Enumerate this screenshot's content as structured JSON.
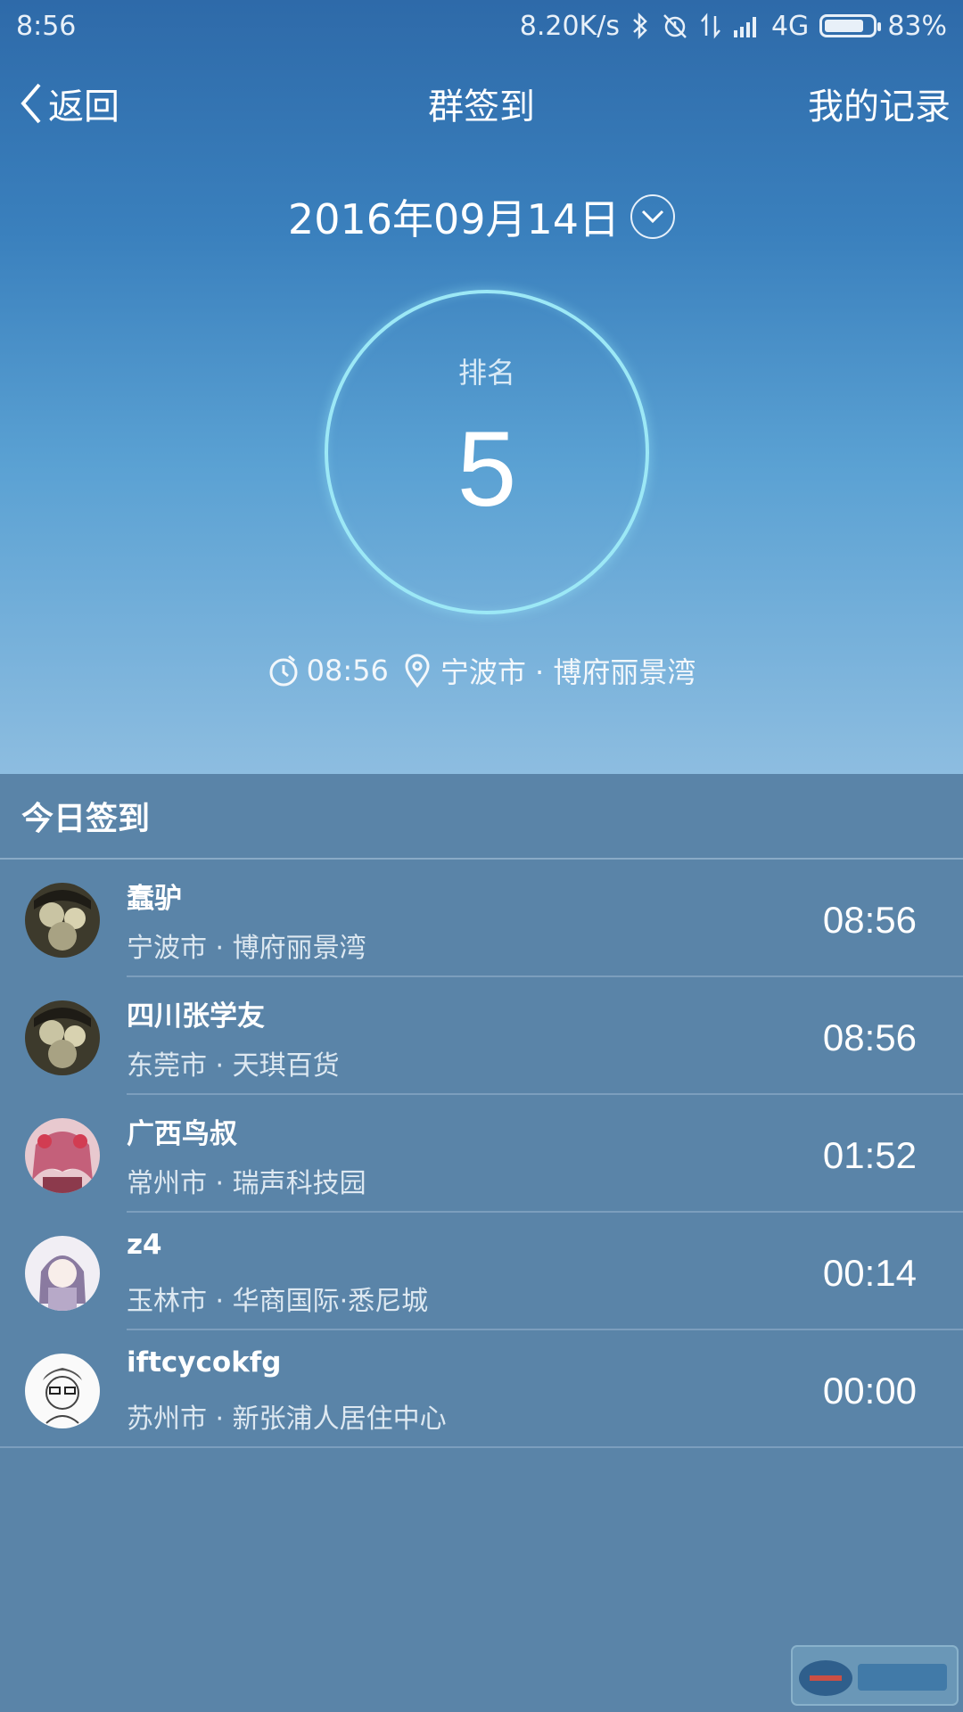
{
  "status_bar": {
    "time": "8:56",
    "network_speed": "8.20K/s",
    "network_type": "4G",
    "battery_percent": "83%",
    "battery_level": 0.83,
    "icons": [
      "bluetooth-icon",
      "alarm-off-icon",
      "data-transfer-icon",
      "signal-icon"
    ]
  },
  "nav": {
    "back_label": "返回",
    "title": "群签到",
    "right_label": "我的记录"
  },
  "date": {
    "value": "2016年09月14日"
  },
  "rank": {
    "label": "排名",
    "value": "5"
  },
  "checkin_meta": {
    "time": "08:56",
    "location": "宁波市 · 博府丽景湾"
  },
  "list": {
    "header": "今日签到",
    "items": [
      {
        "name": "蠢驴",
        "location": "宁波市 · 博府丽景湾",
        "time": "08:56"
      },
      {
        "name": "四川张学友",
        "location": "东莞市 · 天琪百货",
        "time": "08:56"
      },
      {
        "name": "广西鸟叔",
        "location": "常州市 · 瑞声科技园",
        "time": "01:52"
      },
      {
        "name": "z4",
        "location": "玉林市 · 华商国际·悉尼城",
        "time": "00:14"
      },
      {
        "name": "iftcycokfg",
        "location": "苏州市 · 新张浦人居住中心",
        "time": "00:00"
      }
    ]
  },
  "colors": {
    "hero_top": "#2e6aa9",
    "hero_bottom": "#8dbde0",
    "list_bg": "#5a84a8",
    "ring": "#9ce8f6"
  }
}
